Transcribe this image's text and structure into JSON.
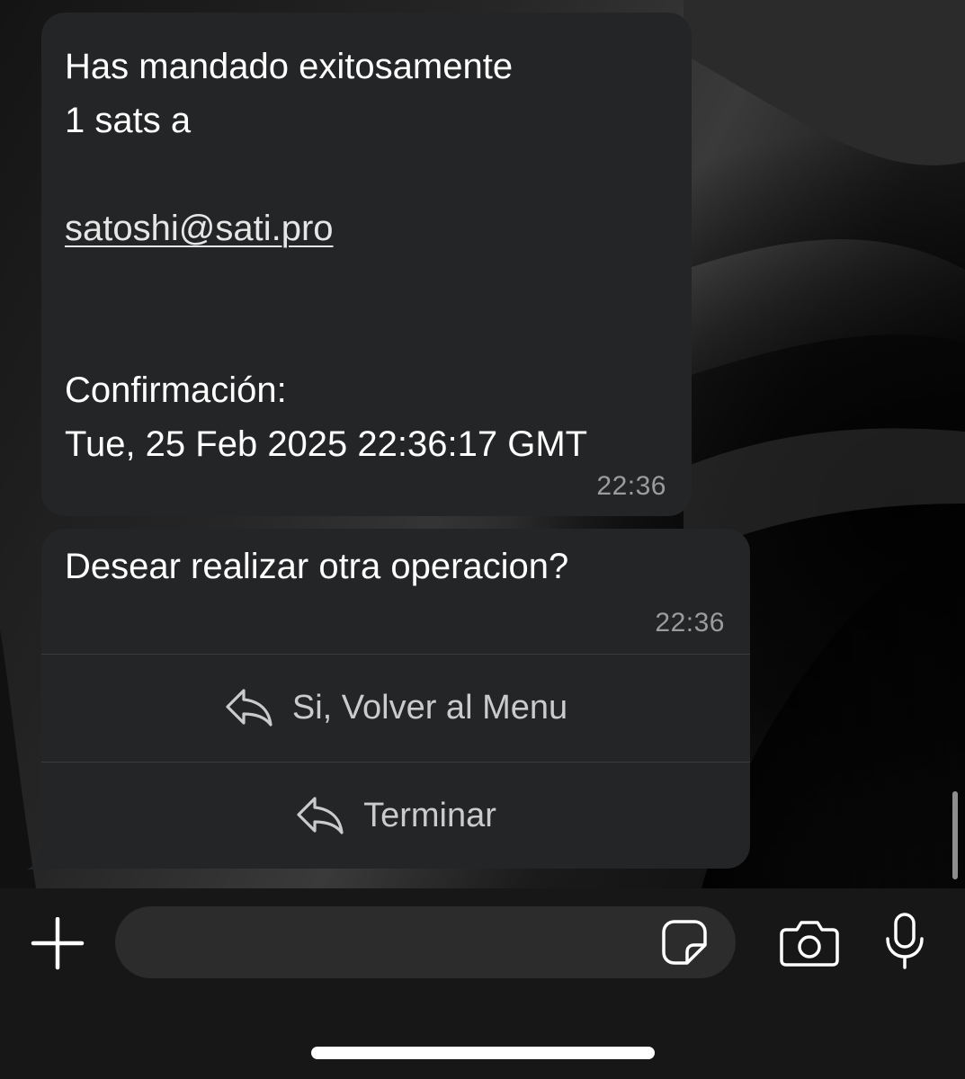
{
  "messages": [
    {
      "lines": [
        "Has mandado exitosamente",
        "1 sats a",
        "",
        "satoshi@sati.pro",
        "",
        "",
        "Confirmación:",
        "Tue, 25 Feb 2025 22:36:17 GMT"
      ],
      "link": "satoshi@sati.pro",
      "time": "22:36"
    },
    {
      "text": "Desear realizar otra operacion?",
      "time": "22:36",
      "quick_replies": [
        {
          "label": "Si, Volver al Menu",
          "icon": "reply-icon"
        },
        {
          "label": "Terminar",
          "icon": "reply-icon"
        }
      ]
    }
  ],
  "composer": {
    "placeholder": "",
    "icons": [
      "plus-icon",
      "sticker-icon",
      "camera-icon",
      "microphone-icon"
    ]
  },
  "colors": {
    "bubble": "#232526",
    "timestamp": "#9a9c9e",
    "composer_bg": "#171717",
    "input_bg": "#2c2c2d"
  }
}
